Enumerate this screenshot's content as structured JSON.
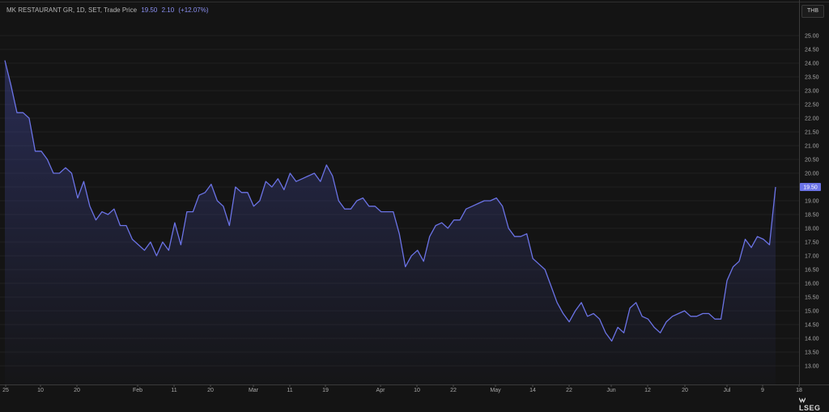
{
  "legend": {
    "name": "MK RESTAURANT GR, 1D, SET, Trade Price",
    "last": "19.50",
    "change": "2.10",
    "change_pct": "(+12.07%)"
  },
  "currency": "THB",
  "brand": "LSEG",
  "colors": {
    "line": "#6b73e6",
    "last_label_bg": "#6b73e6",
    "background": "#141414",
    "grid": "#2a2a2a"
  },
  "chart_data": {
    "type": "area",
    "title": "MK RESTAURANT GR, 1D, SET, Trade Price",
    "xlabel": "",
    "ylabel": "",
    "ylim": [
      12.8,
      25.6
    ],
    "yticks": [
      "13.00",
      "13.50",
      "14.00",
      "14.50",
      "15.00",
      "15.50",
      "16.00",
      "16.50",
      "17.00",
      "17.50",
      "18.00",
      "18.50",
      "19.00",
      "19.50",
      "20.00",
      "20.50",
      "21.00",
      "21.50",
      "22.00",
      "22.50",
      "23.00",
      "23.50",
      "24.00",
      "24.50",
      "25.00"
    ],
    "xtick_labels": [
      "25",
      "10",
      "20",
      "Feb",
      "11",
      "20",
      "Mar",
      "11",
      "19",
      "Apr",
      "10",
      "22",
      "May",
      "14",
      "22",
      "Jun",
      "12",
      "20",
      "Jul",
      "9",
      "18"
    ],
    "last_value_label": "19.50",
    "series": [
      {
        "values": [
          24.1,
          23.2,
          22.2,
          22.2,
          22.0,
          20.8,
          20.8,
          20.5,
          20.0,
          20.0,
          20.2,
          20.0,
          19.1,
          19.7,
          18.8,
          18.3,
          18.6,
          18.5,
          18.7,
          18.1,
          18.1,
          17.6,
          17.4,
          17.2,
          17.5,
          17.0,
          17.5,
          17.2,
          18.2,
          17.4,
          18.6,
          18.6,
          19.2,
          19.3,
          19.6,
          19.0,
          18.8,
          18.1,
          19.5,
          19.3,
          19.3,
          18.8,
          19.0,
          19.7,
          19.5,
          19.8,
          19.4,
          20.0,
          19.7,
          19.8,
          19.9,
          20.0,
          19.7,
          20.3,
          19.9,
          19.0,
          18.7,
          18.7,
          19.0,
          19.1,
          18.8,
          18.8,
          18.6,
          18.6,
          18.6,
          17.8,
          16.6,
          17.0,
          17.2,
          16.8,
          17.7,
          18.1,
          18.2,
          18.0,
          18.3,
          18.3,
          18.7,
          18.8,
          18.9,
          19.0,
          19.0,
          19.1,
          18.8,
          18.0,
          17.7,
          17.7,
          17.8,
          16.9,
          16.7,
          16.5,
          15.9,
          15.3,
          14.9,
          14.6,
          15.0,
          15.3,
          14.8,
          14.9,
          14.7,
          14.2,
          13.9,
          14.4,
          14.2,
          15.1,
          15.3,
          14.8,
          14.7,
          14.4,
          14.2,
          14.6,
          14.8,
          14.9,
          15.0,
          14.8,
          14.8,
          14.9,
          14.9,
          14.7,
          14.7,
          16.1,
          16.6,
          16.8,
          17.6,
          17.3,
          17.7,
          17.6,
          17.4,
          19.5
        ]
      }
    ]
  }
}
